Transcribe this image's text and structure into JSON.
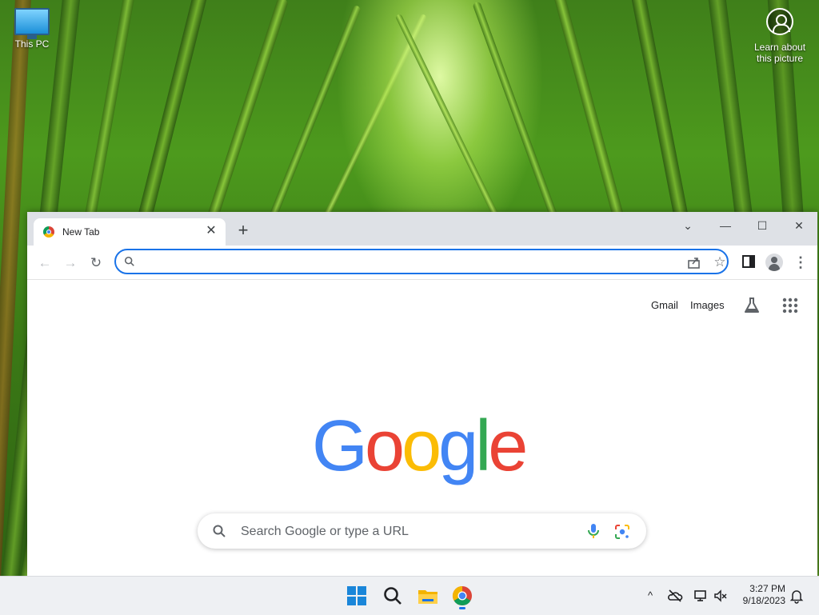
{
  "desktop": {
    "icons": [
      {
        "label": "This PC"
      }
    ],
    "spotlight": {
      "label_line1": "Learn about",
      "label_line2": "this picture"
    }
  },
  "browser": {
    "tab": {
      "title": "New Tab",
      "close_glyph": "✕"
    },
    "new_tab_glyph": "+",
    "window_controls": {
      "tab_search": "⌄",
      "minimize": "—",
      "maximize": "☐",
      "close": "✕"
    },
    "toolbar": {
      "back": "←",
      "forward": "→",
      "reload": "↻",
      "address_value": "",
      "address_placeholder": "",
      "star": "☆",
      "menu": "⋮"
    },
    "content": {
      "gmail_label": "Gmail",
      "images_label": "Images",
      "logo_letters": [
        "G",
        "o",
        "o",
        "g",
        "l",
        "e"
      ],
      "logo_colors": [
        "#4285f4",
        "#ea4335",
        "#fbbc05",
        "#4285f4",
        "#34a853",
        "#ea4335"
      ],
      "search_placeholder": "Search Google or type a URL"
    }
  },
  "taskbar": {
    "apps": [
      "start-icon",
      "search-icon",
      "file-explorer-icon",
      "chrome-icon"
    ],
    "tray": {
      "overflow": "^",
      "time": "3:27 PM",
      "date": "9/18/2023"
    }
  },
  "colors": {
    "accent": "#1a73e8",
    "taskbar_bg": "#eef0f3",
    "titlebar_bg": "#dee1e6"
  }
}
